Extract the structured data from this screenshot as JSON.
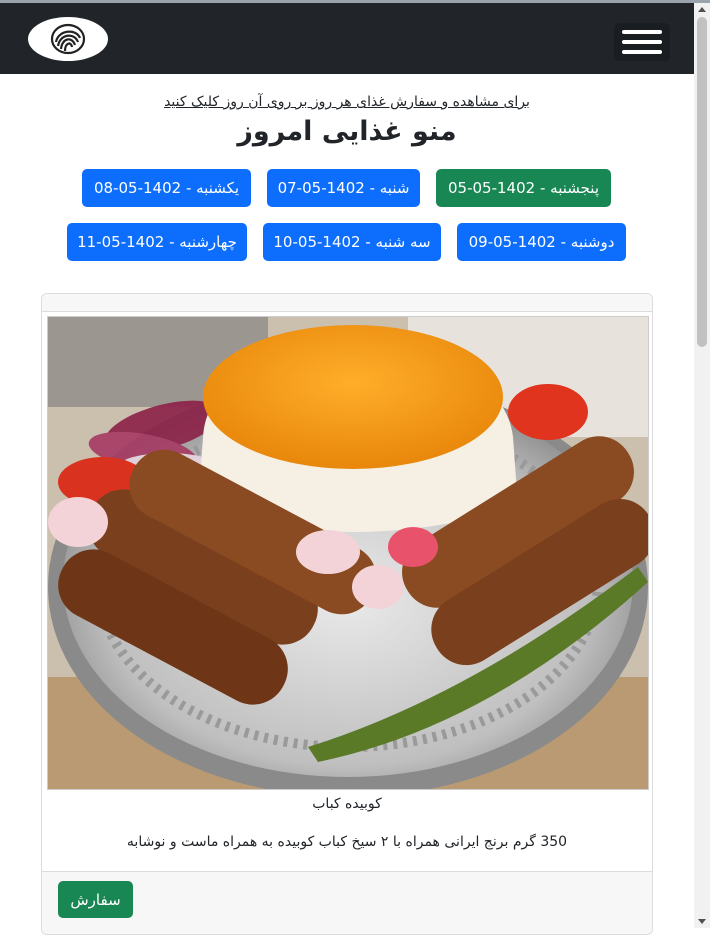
{
  "header": {
    "logo_icon": "spiral-logo-icon",
    "menu_icon": "hamburger-menu-icon"
  },
  "hint": "برای مشاهده و سفارش غذای هر روز بر روی آن روز کلیک کنید",
  "title": "منو غذایی امروز",
  "days": [
    {
      "label": "پنجشنبه - 1402-05-05",
      "active": true
    },
    {
      "label": "شنبه - 1402-05-07",
      "active": false
    },
    {
      "label": "یکشنبه - 1402-05-08",
      "active": false
    },
    {
      "label": "دوشنبه - 1402-05-09",
      "active": false
    },
    {
      "label": "سه شنبه - 1402-05-10",
      "active": false
    },
    {
      "label": "چهارشنبه - 1402-05-11",
      "active": false
    }
  ],
  "food": {
    "image": "koobideh-kebab-plate-photo",
    "name": "کوبیده کباب",
    "description": "350 گرم برنج ایرانی همراه با ۲ سیخ کباب کوبیده به همراه ماست و نوشابه",
    "order_label": "سفارش"
  },
  "colors": {
    "navbar": "#212529",
    "primary": "#0d6efd",
    "success": "#198754"
  }
}
